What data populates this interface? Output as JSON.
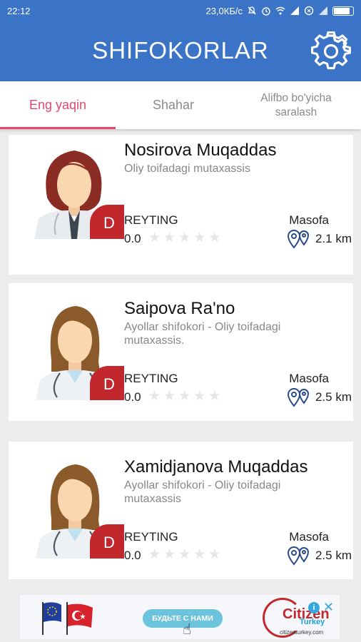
{
  "status_bar": {
    "time": "22:12",
    "network_speed": "23,0КБ/с",
    "icons": [
      "mute-icon",
      "alarm-icon",
      "wifi-icon",
      "signal-icon",
      "data-saver-icon",
      "signal-icon",
      "battery-icon"
    ]
  },
  "app_bar": {
    "title": "SHIFOKORLAR",
    "settings_icon": "gear-icon"
  },
  "tabs": [
    {
      "label": "Eng yaqin",
      "active": true
    },
    {
      "label": "Shahar",
      "active": false
    },
    {
      "label": "Alifbo bo'yicha saralash",
      "active": false
    }
  ],
  "doctors": [
    {
      "name": "Nosirova Muqaddas",
      "specialty": "Oliy toifadagi mutaxassis",
      "badge": "D",
      "rating_label": "REYTING",
      "rating_value": "0.0",
      "rating_stars": 0,
      "distance_label": "Masofa",
      "distance_value": "2.1 km",
      "avatar": "female-doctor-short-hair"
    },
    {
      "name": "Saipova Ra'no",
      "specialty": "Ayollar shifokori - Oliy toifadagi mutaxassis.",
      "badge": "D",
      "rating_label": "REYTING",
      "rating_value": "0.0",
      "rating_stars": 0,
      "distance_label": "Masofa",
      "distance_value": "2.5 km",
      "avatar": "female-doctor-long-hair"
    },
    {
      "name": "Xamidjanova Muqaddas",
      "specialty": "Ayollar shifokori - Oliy toifadagi mutaxassis",
      "badge": "D",
      "rating_label": "REYTING",
      "rating_value": "0.0",
      "rating_stars": 0,
      "distance_label": "Masofa",
      "distance_value": "2.5 km",
      "avatar": "female-doctor-long-hair"
    }
  ],
  "ad": {
    "button_label": "БУДЬТЕ С НАМИ",
    "brand": "Citizen",
    "brand_sub": "Turkey",
    "url": "citizenturkey.com"
  },
  "colors": {
    "primary": "#3b74c7",
    "accent": "#e0486d",
    "badge": "#c1272d"
  }
}
